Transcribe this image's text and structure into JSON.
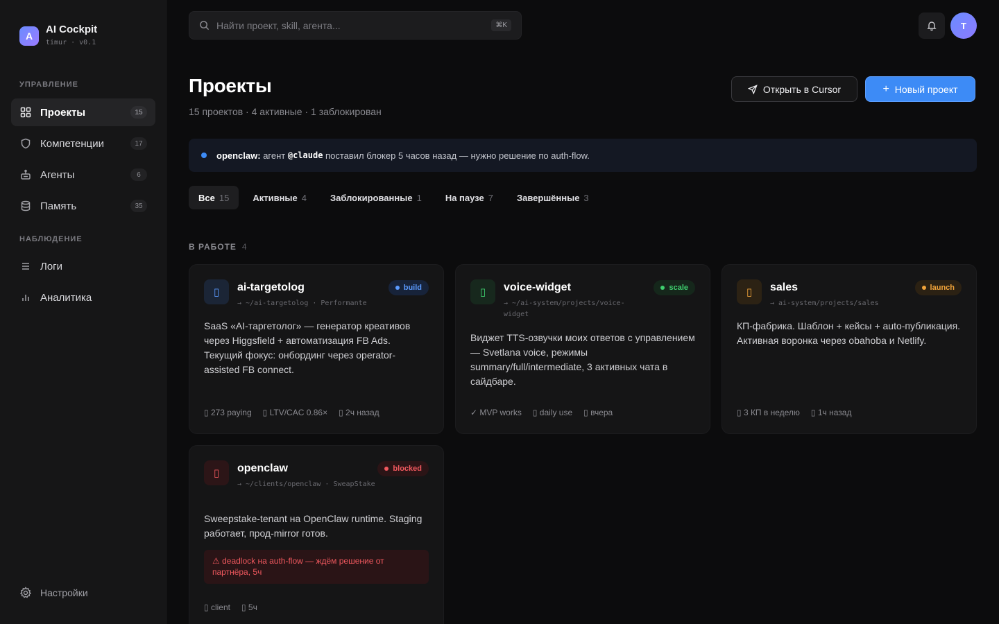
{
  "brand": {
    "logo_letter": "A",
    "title": "AI Cockpit",
    "subtitle": "timur · v0.1"
  },
  "sidebar": {
    "section_manage": "УПРАВЛЕНИЕ",
    "section_observe": "НАБЛЮДЕНИЕ",
    "items": [
      {
        "label": "Проекты",
        "count": "15",
        "icon": "grid-icon",
        "active": true
      },
      {
        "label": "Компетенции",
        "count": "17",
        "icon": "shield-icon"
      },
      {
        "label": "Агенты",
        "count": "6",
        "icon": "robot-icon"
      },
      {
        "label": "Память",
        "count": "35",
        "icon": "database-icon"
      },
      {
        "label": "Логи",
        "icon": "list-icon"
      },
      {
        "label": "Аналитика",
        "icon": "bar-chart-icon"
      }
    ],
    "settings_label": "Настройки"
  },
  "search": {
    "placeholder": "Найти проект, skill, агента...",
    "shortcut": "⌘K"
  },
  "user": {
    "avatar_letter": "T"
  },
  "header": {
    "title": "Проекты",
    "subtitle": "15 проектов · 4 активные · 1 заблокирован",
    "open_cursor_label": "Открыть в Cursor",
    "new_project_label": "Новый проект",
    "new_project_icon": "+"
  },
  "alert": {
    "project": "openclaw:",
    "text_before": " агент ",
    "agent": "@claude",
    "text_after": " поставил блокер 5 часов назад — нужно решение по auth-flow."
  },
  "tabs": [
    {
      "label": "Все",
      "count": "15",
      "active": true
    },
    {
      "label": "Активные",
      "count": "4"
    },
    {
      "label": "Заблокированные",
      "count": "1"
    },
    {
      "label": "На паузе",
      "count": "7"
    },
    {
      "label": "Завершённые",
      "count": "3"
    }
  ],
  "section": {
    "title": "В РАБОТЕ",
    "count": "4"
  },
  "cards": [
    {
      "name": "ai-targetolog",
      "path": "→ ~/ai-targetolog · Performante",
      "badge": "build",
      "badge_color": "#5b9bff",
      "description": "SaaS «AI-таргетолог» — генератор креативов через Higgsfield + автоматизация FB Ads. Текущий фокус: онбординг через operator-assisted FB connect.",
      "meta": [
        "▯ 273 paying",
        "▯ LTV/CAC 0.86×",
        "▯ 2ч назад"
      ]
    },
    {
      "name": "voice-widget",
      "path": "→ ~/ai-system/projects/voice-widget",
      "badge": "scale",
      "badge_color": "#3ecf6e",
      "description": "Виджет TTS-озвучки моих ответов с управлением — Svetlana voice, режимы summary/full/intermediate, 3 активных чата в сайдбаре.",
      "meta": [
        "✓ MVP works",
        "▯ daily use",
        "▯ вчера"
      ]
    },
    {
      "name": "sales",
      "path": "→ ai-system/projects/sales",
      "badge": "launch",
      "badge_color": "#f0a33a",
      "description": "КП-фабрика. Шаблон + кейсы + auto-публикация. Активная воронка через obahoba и Netlify.",
      "meta": [
        "▯ 3 КП в неделю",
        "▯ 1ч назад"
      ]
    },
    {
      "name": "openclaw",
      "path": "→ ~/clients/openclaw · SweapStake",
      "badge": "blocked",
      "badge_color": "#f0585e",
      "description": "Sweepstake-tenant на OpenClaw runtime. Staging работает, прод-mirror готов.",
      "warning": "⚠ deadlock на auth-flow — ждём решение от партнёра, 5ч",
      "meta": [
        "▯ client",
        "▯ 5ч"
      ]
    }
  ]
}
